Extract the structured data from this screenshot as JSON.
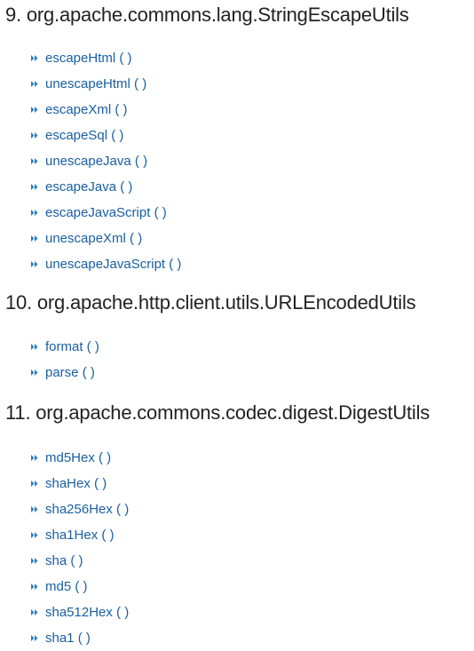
{
  "sections": [
    {
      "heading": "9. org.apache.commons.lang.StringEscapeUtils",
      "methods": [
        "escapeHtml ( )",
        "unescapeHtml ( )",
        "escapeXml ( )",
        "escapeSql ( )",
        "unescapeJava ( )",
        "escapeJava ( )",
        "escapeJavaScript ( )",
        "unescapeXml ( )",
        "unescapeJavaScript ( )"
      ]
    },
    {
      "heading": "10. org.apache.http.client.utils.URLEncodedUtils",
      "methods": [
        "format ( )",
        "parse ( )"
      ]
    },
    {
      "heading": "11. org.apache.commons.codec.digest.DigestUtils",
      "methods": [
        "md5Hex ( )",
        "shaHex ( )",
        "sha256Hex ( )",
        "sha1Hex ( )",
        "sha ( )",
        "md5 ( )",
        "sha512Hex ( )",
        "sha1 ( )"
      ]
    }
  ],
  "colors": {
    "heading": "#222222",
    "link": "#1a5fa0",
    "bullet": "#2a7fc0"
  },
  "icons": {
    "bullet": "double-chevron-right-icon"
  }
}
